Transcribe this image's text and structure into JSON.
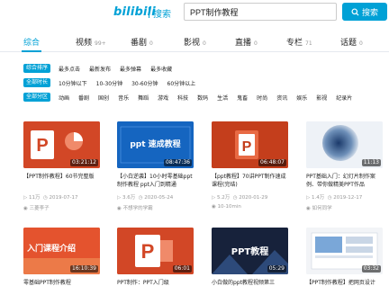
{
  "header": {
    "logo": "bilibili",
    "logo_sub": "搜索",
    "search_value": "PPT制作教程",
    "search_button": "搜索"
  },
  "tabs": [
    {
      "label": "综合",
      "count": ""
    },
    {
      "label": "视频",
      "count": "99+"
    },
    {
      "label": "番剧",
      "count": "0"
    },
    {
      "label": "影视",
      "count": "0"
    },
    {
      "label": "直播",
      "count": "0"
    },
    {
      "label": "专栏",
      "count": "71"
    },
    {
      "label": "话题",
      "count": "0"
    }
  ],
  "filters": {
    "order": {
      "tag": "综合排序",
      "options": [
        "最多点击",
        "最新发布",
        "最多弹幕",
        "最多收藏"
      ]
    },
    "duration": {
      "tag": "全部时长",
      "options": [
        "10分钟以下",
        "10-30分钟",
        "30-60分钟",
        "60分钟以上"
      ]
    },
    "zone": {
      "tag": "全部分区",
      "options": [
        "动画",
        "番剧",
        "国创",
        "音乐",
        "舞蹈",
        "游戏",
        "科技",
        "数码",
        "生活",
        "鬼畜",
        "时尚",
        "资讯",
        "娱乐",
        "影视",
        "纪录片"
      ]
    }
  },
  "videos": [
    {
      "title": "【PPT制作教程】60节完整版",
      "duration": "03:21:12",
      "plays": "11万",
      "date": "2019-07-17",
      "uploader": "三菱李子"
    },
    {
      "title": "【小白逆袭】10小时零基础ppt制作教程 ppt入门到精通",
      "duration": "08:47:36",
      "plays": "3.6万",
      "date": "2020-05-24",
      "uploader": "不想学的学霸"
    },
    {
      "title": "【ppt教程】70讲PPT制作速成课程(完结)",
      "duration": "06:48:07",
      "plays": "5.2万",
      "date": "2020-01-29",
      "uploader": "10-10min"
    },
    {
      "title": "PPT基础入门：幻灯片制作案例、带你做精美PPT作品",
      "duration": "11:13",
      "plays": "1.4万",
      "date": "2019-12-17",
      "uploader": "如何同学"
    },
    {
      "title": "零基础PPT制作教程",
      "duration": "16:10:39",
      "plays": "",
      "date": "",
      "uploader": ""
    },
    {
      "title": "PPT制作：PPT入门级",
      "duration": "06:01",
      "plays": "",
      "date": "",
      "uploader": ""
    },
    {
      "title": "小白做的ppt教程视频第三",
      "duration": "05:29",
      "plays": "",
      "date": "",
      "uploader": ""
    },
    {
      "title": "【PPT制作教程】把网页设计",
      "duration": "03:32",
      "plays": "",
      "date": "",
      "uploader": ""
    }
  ],
  "thumb_text": {
    "t2": "ppt 速成教程",
    "t5": "入门课程介绍",
    "t7": "PPT教程"
  }
}
